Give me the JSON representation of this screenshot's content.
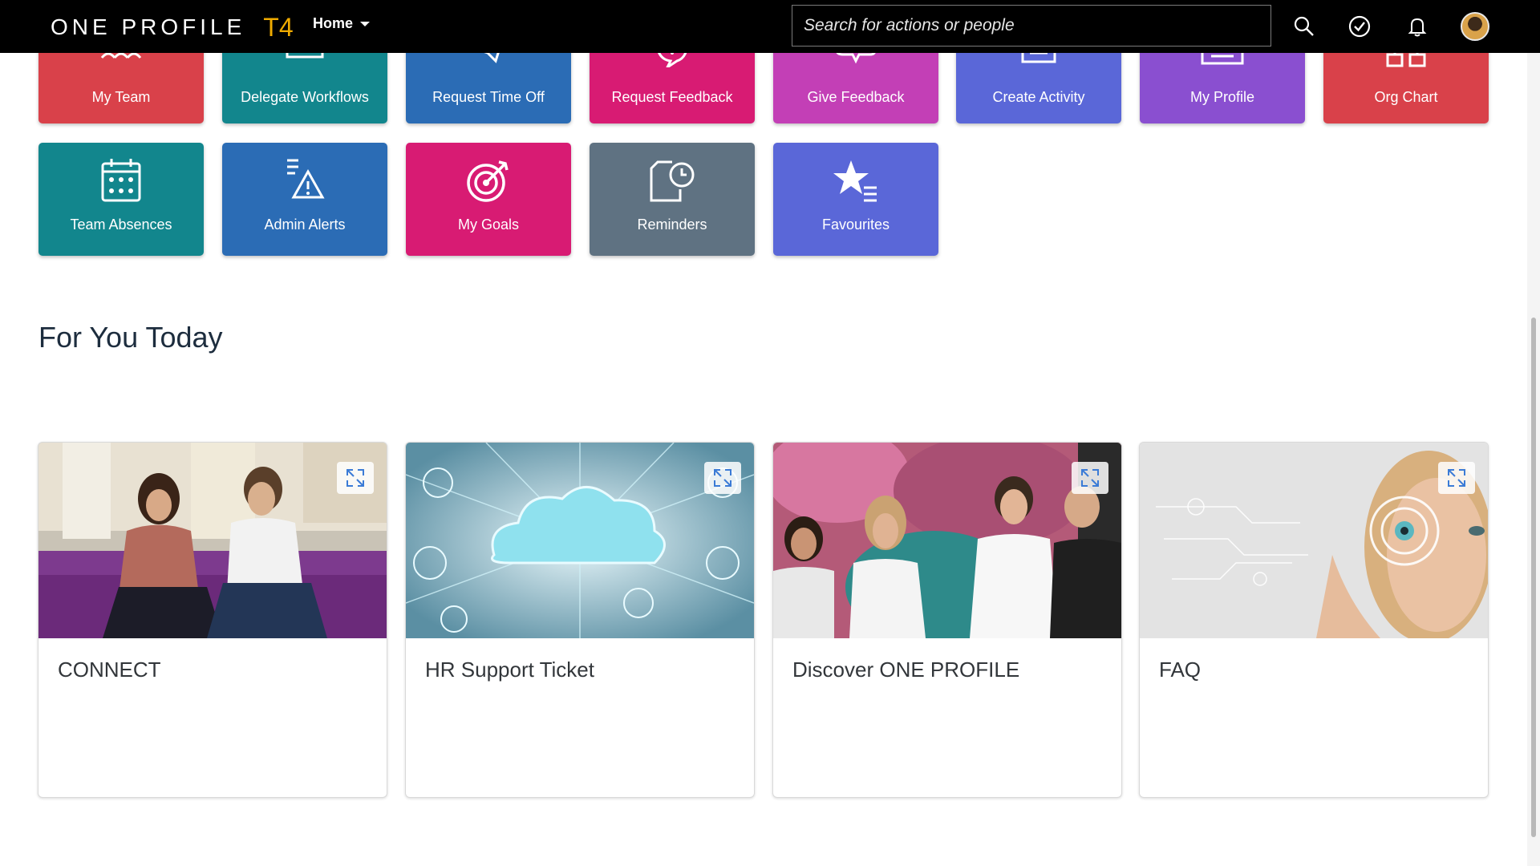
{
  "app": {
    "logo_main": "ONE PROFILE",
    "logo_suffix": "T4",
    "home_menu_label": "Home",
    "search_placeholder": "Search for actions or people"
  },
  "quick_links": {
    "row1": [
      {
        "label": "My Team",
        "color": "#d9414a",
        "icon": "team-icon"
      },
      {
        "label": "Delegate Workflows",
        "color": "#12868d",
        "icon": "delegate-icon"
      },
      {
        "label": "Request Time Off",
        "color": "#2b6cb5",
        "icon": "plane-icon"
      },
      {
        "label": "Request Feedback",
        "color": "#d81b73",
        "icon": "feedback-request-icon"
      },
      {
        "label": "Give Feedback",
        "color": "#c33fb6",
        "icon": "feedback-give-icon"
      },
      {
        "label": "Create Activity",
        "color": "#5a67d8",
        "icon": "activity-icon"
      },
      {
        "label": "My Profile",
        "color": "#8a4fd0",
        "icon": "profile-icon"
      },
      {
        "label": "Org Chart",
        "color": "#d9414a",
        "icon": "org-chart-icon"
      }
    ],
    "row2": [
      {
        "label": "Team Absences",
        "color": "#12868d",
        "icon": "calendar-icon"
      },
      {
        "label": "Admin Alerts",
        "color": "#2b6cb5",
        "icon": "alert-icon"
      },
      {
        "label": "My Goals",
        "color": "#d81b73",
        "icon": "target-icon"
      },
      {
        "label": "Reminders",
        "color": "#5f7282",
        "icon": "reminder-icon"
      },
      {
        "label": "Favourites",
        "color": "#5a67d8",
        "icon": "star-icon"
      }
    ]
  },
  "for_you_today": {
    "title": "For You Today",
    "cards": [
      {
        "title": "CONNECT"
      },
      {
        "title": "HR Support Ticket"
      },
      {
        "title": "Discover ONE PROFILE"
      },
      {
        "title": "FAQ"
      }
    ]
  }
}
